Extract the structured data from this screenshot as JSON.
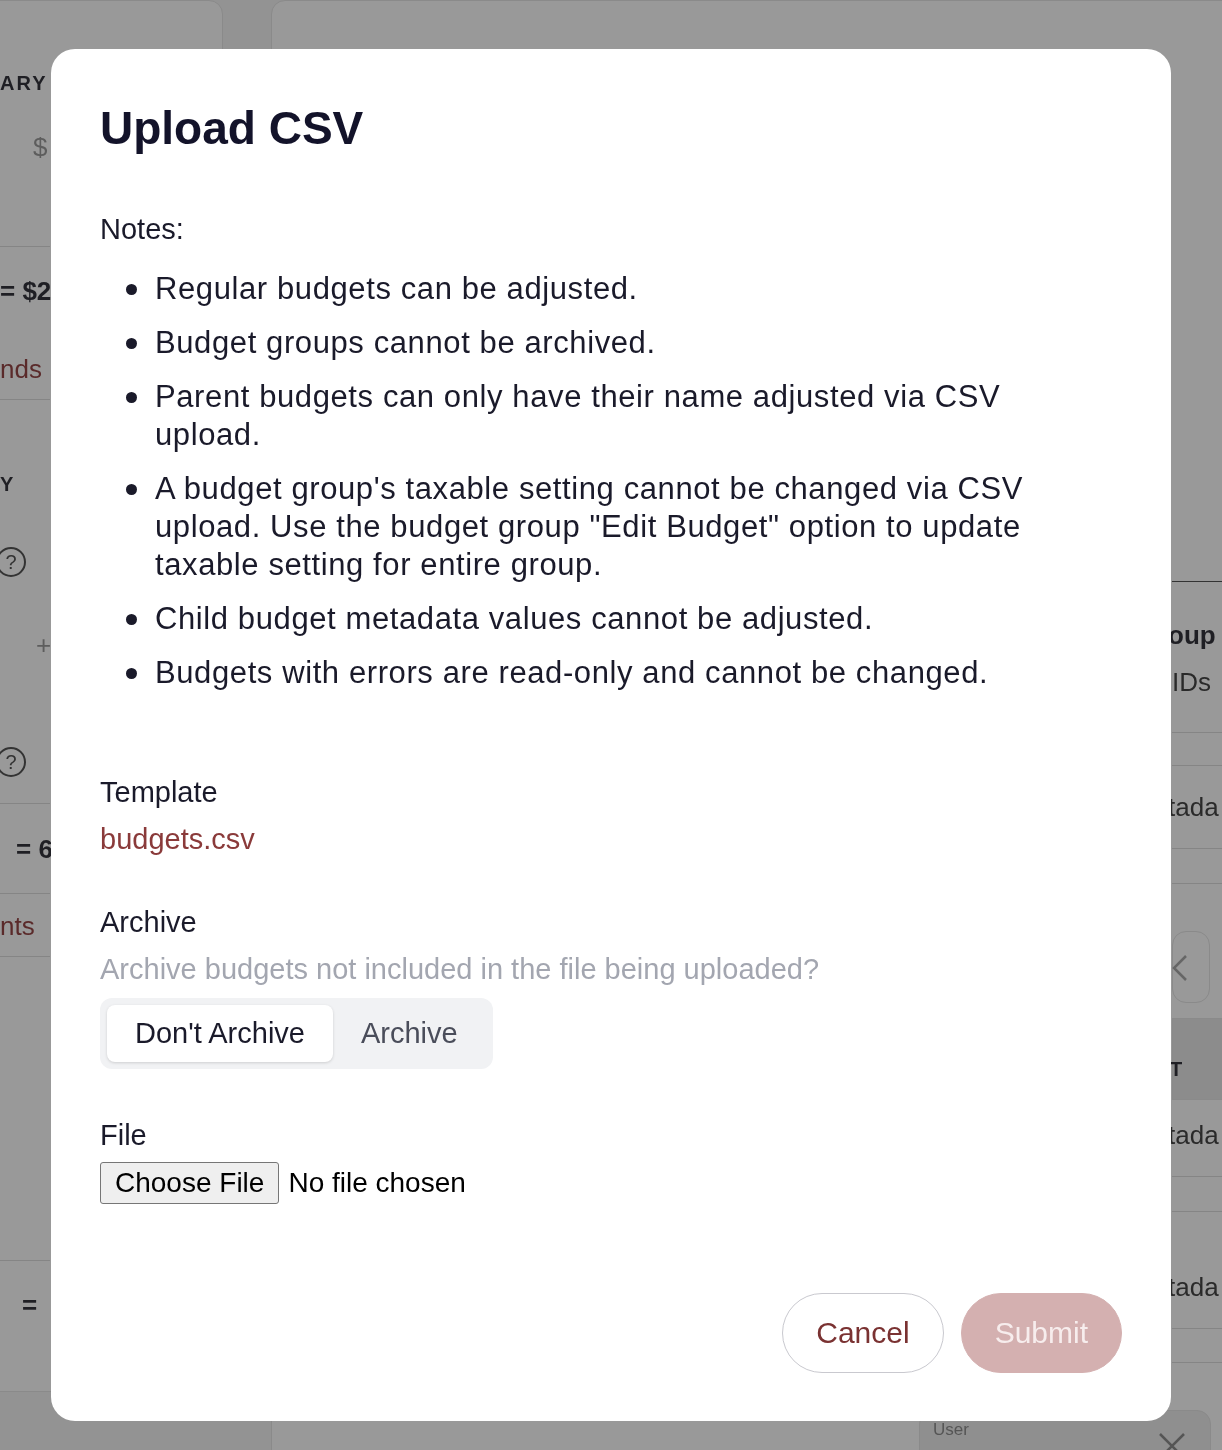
{
  "backdrop": {
    "left_texts": [
      {
        "text": "ARY",
        "kind": "heading"
      },
      {
        "text": "$",
        "kind": "muted"
      },
      {
        "text": "= $2",
        "kind": "total"
      },
      {
        "text": "nds",
        "kind": "link"
      },
      {
        "text": "Y",
        "kind": "heading"
      },
      {
        "text": "+",
        "kind": "muted"
      },
      {
        "text": "= 6",
        "kind": "total"
      },
      {
        "text": "nts",
        "kind": "link"
      },
      {
        "text": "=",
        "kind": "total"
      }
    ],
    "left_icons": [
      "?",
      "?"
    ],
    "right_texts": [
      {
        "text": "oup",
        "kind": "total"
      },
      {
        "text": "IDs",
        "kind": "plain"
      },
      {
        "text": "tada",
        "kind": "plain"
      },
      {
        "text": "T",
        "kind": "heading"
      },
      {
        "text": "tada",
        "kind": "plain"
      },
      {
        "text": "tada",
        "kind": "plain"
      },
      {
        "text": "User",
        "kind": "small"
      }
    ]
  },
  "dialog": {
    "title": "Upload CSV",
    "notes_label": "Notes:",
    "notes": [
      "Regular budgets can be adjusted.",
      "Budget groups cannot be archived.",
      "Parent budgets can only have their name adjusted via CSV upload.",
      "A budget group's taxable setting cannot be changed via CSV upload. Use the budget group \"Edit Budget\" option to update taxable setting for entire group.",
      "Child budget metadata values cannot be adjusted.",
      "Budgets with errors are read-only and cannot be changed."
    ],
    "template": {
      "label": "Template",
      "link": "budgets.csv"
    },
    "archive": {
      "label": "Archive",
      "hint": "Archive budgets not included in the file being uploaded?",
      "options": [
        {
          "label": "Don't Archive",
          "selected": true
        },
        {
          "label": "Archive",
          "selected": false
        }
      ]
    },
    "file": {
      "label": "File",
      "button": "Choose File",
      "status": "No file chosen"
    },
    "actions": [
      {
        "kind": "secondary",
        "label": "Cancel",
        "disabled": false
      },
      {
        "kind": "primary",
        "label": "Submit",
        "disabled": true
      }
    ]
  }
}
